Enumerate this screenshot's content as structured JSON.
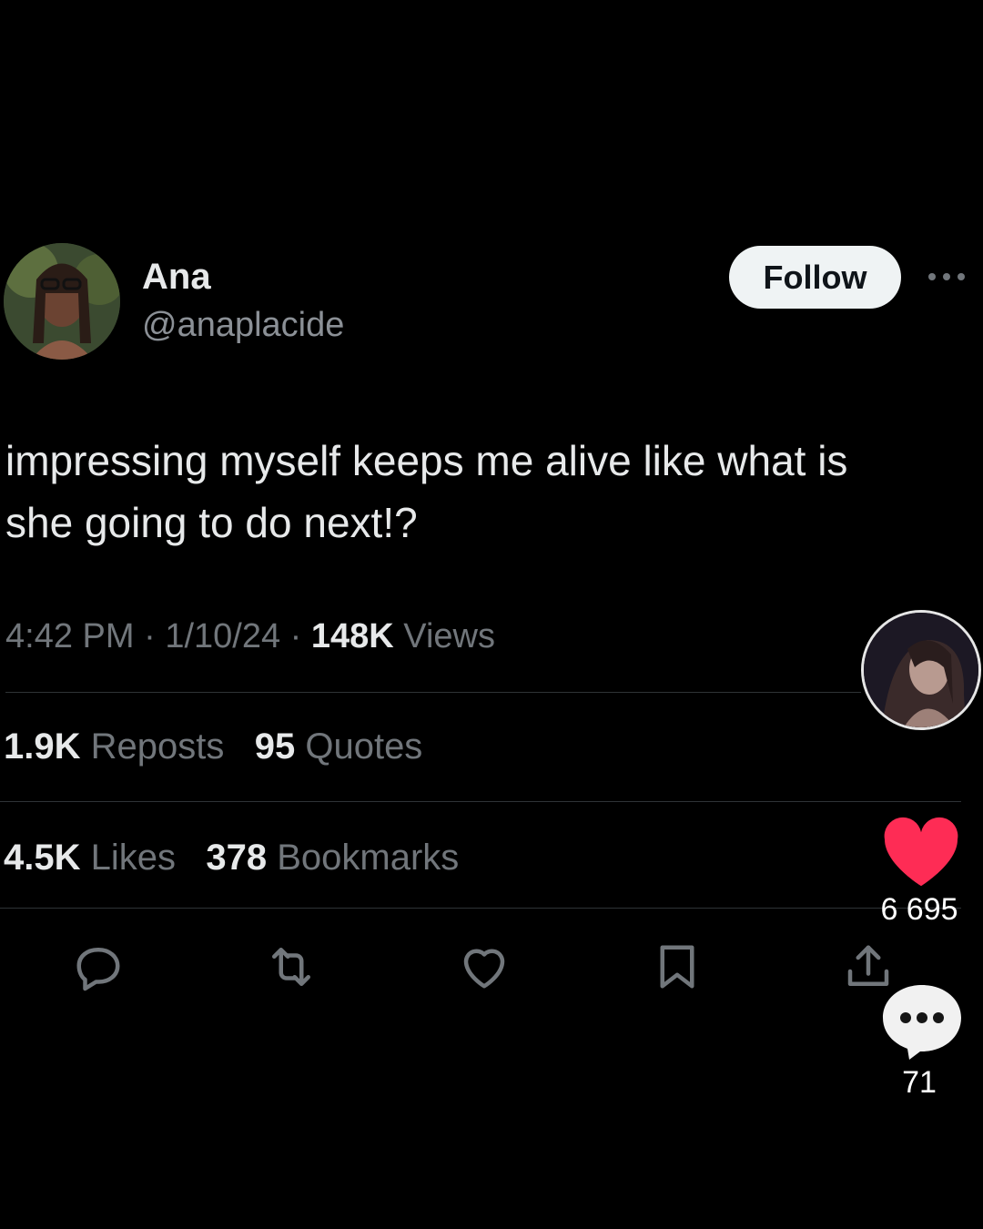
{
  "tweet": {
    "author_name": "Ana",
    "author_handle": "@anaplacide",
    "follow_label": "Follow",
    "text": "impressing myself keeps me alive like what is she going to do next!?",
    "time": "4:42 PM",
    "date": "1/10/24",
    "views_count": "148K",
    "views_label": "Views",
    "reposts_count": "1.9K",
    "reposts_label": "Reposts",
    "quotes_count": "95",
    "quotes_label": "Quotes",
    "likes_count": "4.5K",
    "likes_label": "Likes",
    "bookmarks_count": "378",
    "bookmarks_label": "Bookmarks"
  },
  "actions": [
    "reply-icon",
    "repost-icon",
    "like-icon",
    "bookmark-icon",
    "share-icon"
  ],
  "overlay": {
    "like_count": "6 695",
    "comment_count": "71",
    "heart_color": "#fe2c55"
  }
}
